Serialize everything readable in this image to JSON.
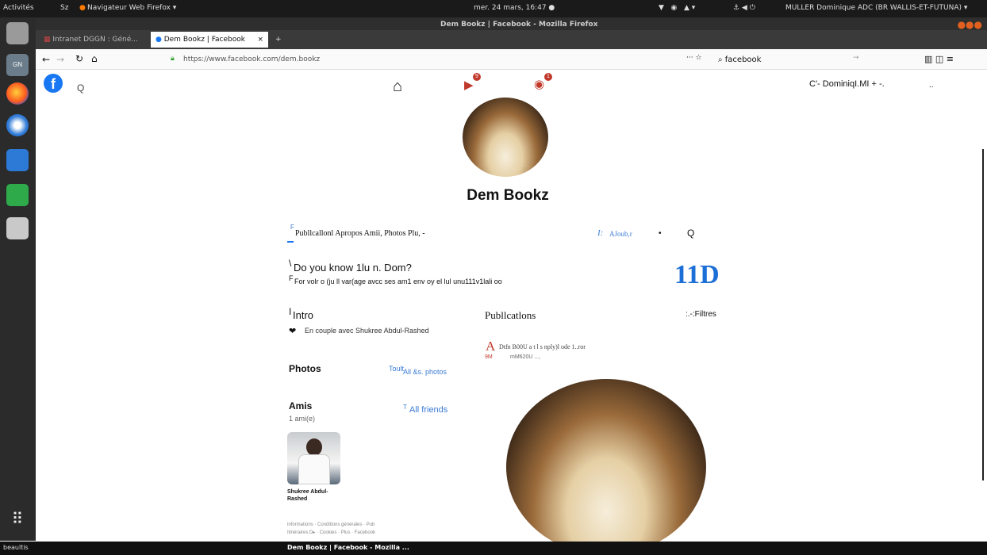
{
  "system": {
    "activities": "Activités",
    "indicator": "Sz",
    "app_menu": "Navigateur Web Firefox ▾",
    "clock": "mer. 24 mars, 16:47 ●",
    "user": "MULLER Dominique ADC (BR WALLIS-ET-FUTUNA) ▾",
    "taskbar_left": "beaultis",
    "taskbar_window": "Dem Bookz | Facebook - Mozilla ..."
  },
  "browser": {
    "window_title": "Dem Bookz | Facebook - Mozilla Firefox",
    "tabs": [
      {
        "label": "Intranet DGGN : Géné..."
      },
      {
        "label": "Dem Bookz | Facebook"
      }
    ],
    "url": "https://www.facebook.com/dem.bookz",
    "search_value": "facebook"
  },
  "facebook": {
    "header_user": "C'- DominiqI.MI + -.",
    "header_more": "..",
    "header_badge_video": "9",
    "header_badge_groups": "1",
    "page_name": "Dem Bookz",
    "nav_tabs": "Publlcallonl Apropos Amii, Photos Plu, -",
    "nav_marker": "F",
    "add_prefix": "I:",
    "add_label": "AJoub,r",
    "nav_dot": "•",
    "nav_search": "Q",
    "search_icon_glyph": "Q",
    "didyouknow_marker": "\\",
    "didyouknow_title": "Do you know 1lu n. Dom?",
    "didyouknow_prefix": "F",
    "didyouknow_text": "For volr o (ju ll var(age avcc ses am1 env oy el lul unu111v1lali oo",
    "big_count": "11D",
    "intro_marker": "I",
    "intro_title": "Intro",
    "intro_relationship": "En couple avec Shukree Abdul-Rashed",
    "photos_title": "Photos",
    "photos_link_prefix": "Toult",
    "photos_link": "All &s. photos",
    "friends_title": "Amis",
    "friends_count": "1 ami(e)",
    "friends_link_prefix": "T",
    "friends_link": "All friends",
    "friend_name": "Shukree Abdul-Rashed",
    "footer_line1": "informations · Conditions générales · Pub",
    "footer_line2": "Itinéraires D▸ · Cookies · Plus · Facebook",
    "posts_title": "Publlcatlons",
    "filters_label": ":.-:Filtres",
    "post_initial": "A",
    "post_author": "Dtfn B00U a t l s nply)l ode 1..ror",
    "post_time_a": "9M",
    "post_time_b": "mM620U ...,"
  }
}
